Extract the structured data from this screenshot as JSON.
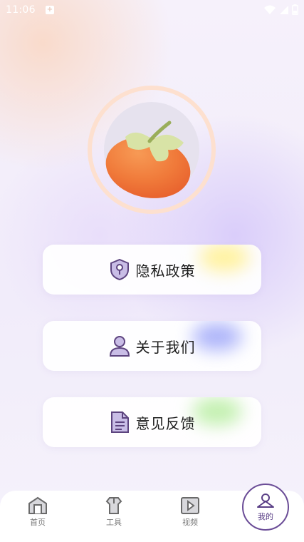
{
  "status_bar": {
    "time": "11:06",
    "icons": [
      "notification-icon",
      "wifi-icon",
      "signal-icon",
      "battery-icon"
    ]
  },
  "menu": [
    {
      "label": "隐私政策",
      "icon": "shield-icon",
      "glow": "#fff3a8"
    },
    {
      "label": "关于我们",
      "icon": "person-icon",
      "glow": "#b7bdfa"
    },
    {
      "label": "意见反馈",
      "icon": "document-icon",
      "glow": "#c8f2b8"
    }
  ],
  "nav": {
    "tabs": [
      {
        "label": "首页",
        "icon": "home-icon",
        "active": false
      },
      {
        "label": "工具",
        "icon": "tools-icon",
        "active": false
      },
      {
        "label": "视频",
        "icon": "video-icon",
        "active": false
      },
      {
        "label": "我的",
        "icon": "profile-icon",
        "active": true
      }
    ],
    "accent": "#6b4d97"
  }
}
